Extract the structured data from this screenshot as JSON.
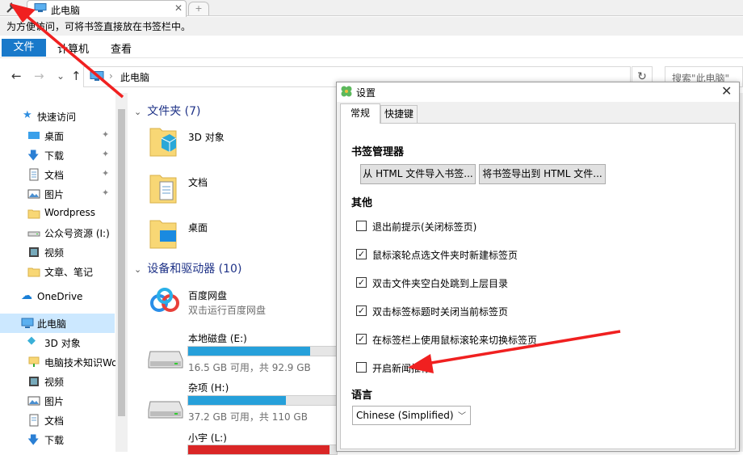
{
  "tabs": {
    "active_title": "此电脑",
    "close_glyph": "✕",
    "new_tab_glyph": "+"
  },
  "bookmark_bar": {
    "hint": "为方便访问，可将书签直接放在书签栏中。"
  },
  "ribbon": {
    "file": "文件",
    "computer": "计算机",
    "view": "查看"
  },
  "nav": {
    "back": "←",
    "forward": "→",
    "recent": "⌄",
    "up": "↑",
    "address_sep": "›",
    "address": "此电脑",
    "refresh": "↻",
    "search_placeholder": "搜索\"此电脑\""
  },
  "sidebar": {
    "quick_access": "快速访问",
    "items": [
      {
        "label": "桌面",
        "pinned": true
      },
      {
        "label": "下载",
        "pinned": true
      },
      {
        "label": "文档",
        "pinned": true
      },
      {
        "label": "图片",
        "pinned": true
      },
      {
        "label": "Wordpress",
        "pinned": false
      },
      {
        "label": "公众号资源 (I:)",
        "pinned": false
      },
      {
        "label": "视频",
        "pinned": false
      },
      {
        "label": "文章、笔记",
        "pinned": false
      }
    ],
    "onedrive": "OneDrive",
    "this_pc": "此电脑",
    "pc_items": [
      "3D 对象",
      "电脑技术知识Wo",
      "视频",
      "图片",
      "文档",
      "下载"
    ],
    "pin_glyph": "📌"
  },
  "main": {
    "folders_header": "文件夹 (7)",
    "folders": [
      "3D 对象",
      "文档",
      "桌面"
    ],
    "devices_header": "设备和驱动器 (10)",
    "drives": [
      {
        "name": "百度网盘",
        "sub": "双击运行百度网盘"
      },
      {
        "name": "本地磁盘 (E:)",
        "sub": "16.5 GB 可用，共 92.9 GB",
        "used_fraction": 0.82,
        "color": "#26a0da"
      },
      {
        "name": "杂项 (H:)",
        "sub": "37.2 GB 可用，共 110 GB",
        "used_fraction": 0.66,
        "color": "#26a0da"
      },
      {
        "name": "小宇 (L:)",
        "sub": "",
        "used_fraction": 0.95,
        "color": "#da2626"
      }
    ]
  },
  "dialog": {
    "title": "设置",
    "close": "✕",
    "tabs": [
      "常规",
      "快捷键"
    ],
    "bookmark_section": "书签管理器",
    "import_button": "从 HTML 文件导入书签...",
    "export_button": "将书签导出到 HTML 文件...",
    "other_section": "其他",
    "options": [
      {
        "label": "退出前提示(关闭标签页)",
        "checked": false
      },
      {
        "label": "鼠标滚轮点选文件夹时新建标签页",
        "checked": true
      },
      {
        "label": "双击文件夹空白处跳到上层目录",
        "checked": true
      },
      {
        "label": "双击标签标题时关闭当前标签页",
        "checked": true
      },
      {
        "label": "在标签栏上使用鼠标滚轮来切换标签页",
        "checked": true
      },
      {
        "label": "开启新闻推荐",
        "checked": false
      }
    ],
    "language_section": "语言",
    "language_value": "Chinese (Simplified)",
    "check_glyph": "✓"
  },
  "colors": {
    "ribbon_file": "#1979ca",
    "selection": "#cce8ff",
    "group_header": "#1e3287",
    "annotation": "#f02020"
  }
}
